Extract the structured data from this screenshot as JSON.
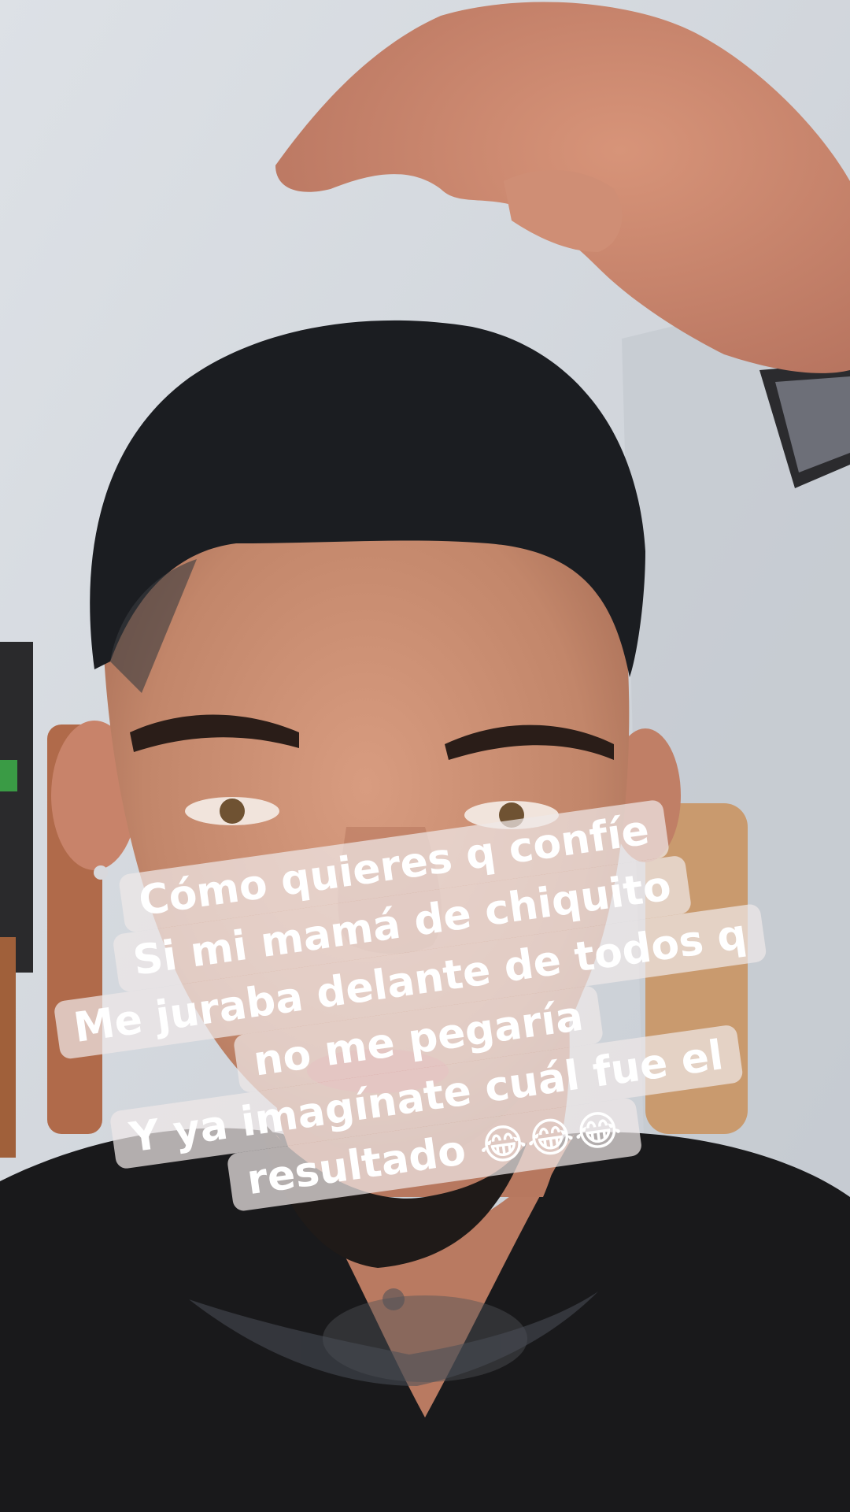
{
  "caption": {
    "lines": [
      "Cómo quieres q confíe",
      "Si mi mamá de chiquito",
      "Me juraba delante de todos q",
      "no me pegaría",
      "Y ya imagínate cuál fue el",
      "resultado 😂😂😂"
    ]
  },
  "photo": {
    "subject": "man with fresh fade haircut",
    "colors": {
      "wall": "#d3d7dc",
      "hair": "#1c1e22",
      "skin": "#c48a70",
      "shirt": "#1a1a1c"
    }
  }
}
